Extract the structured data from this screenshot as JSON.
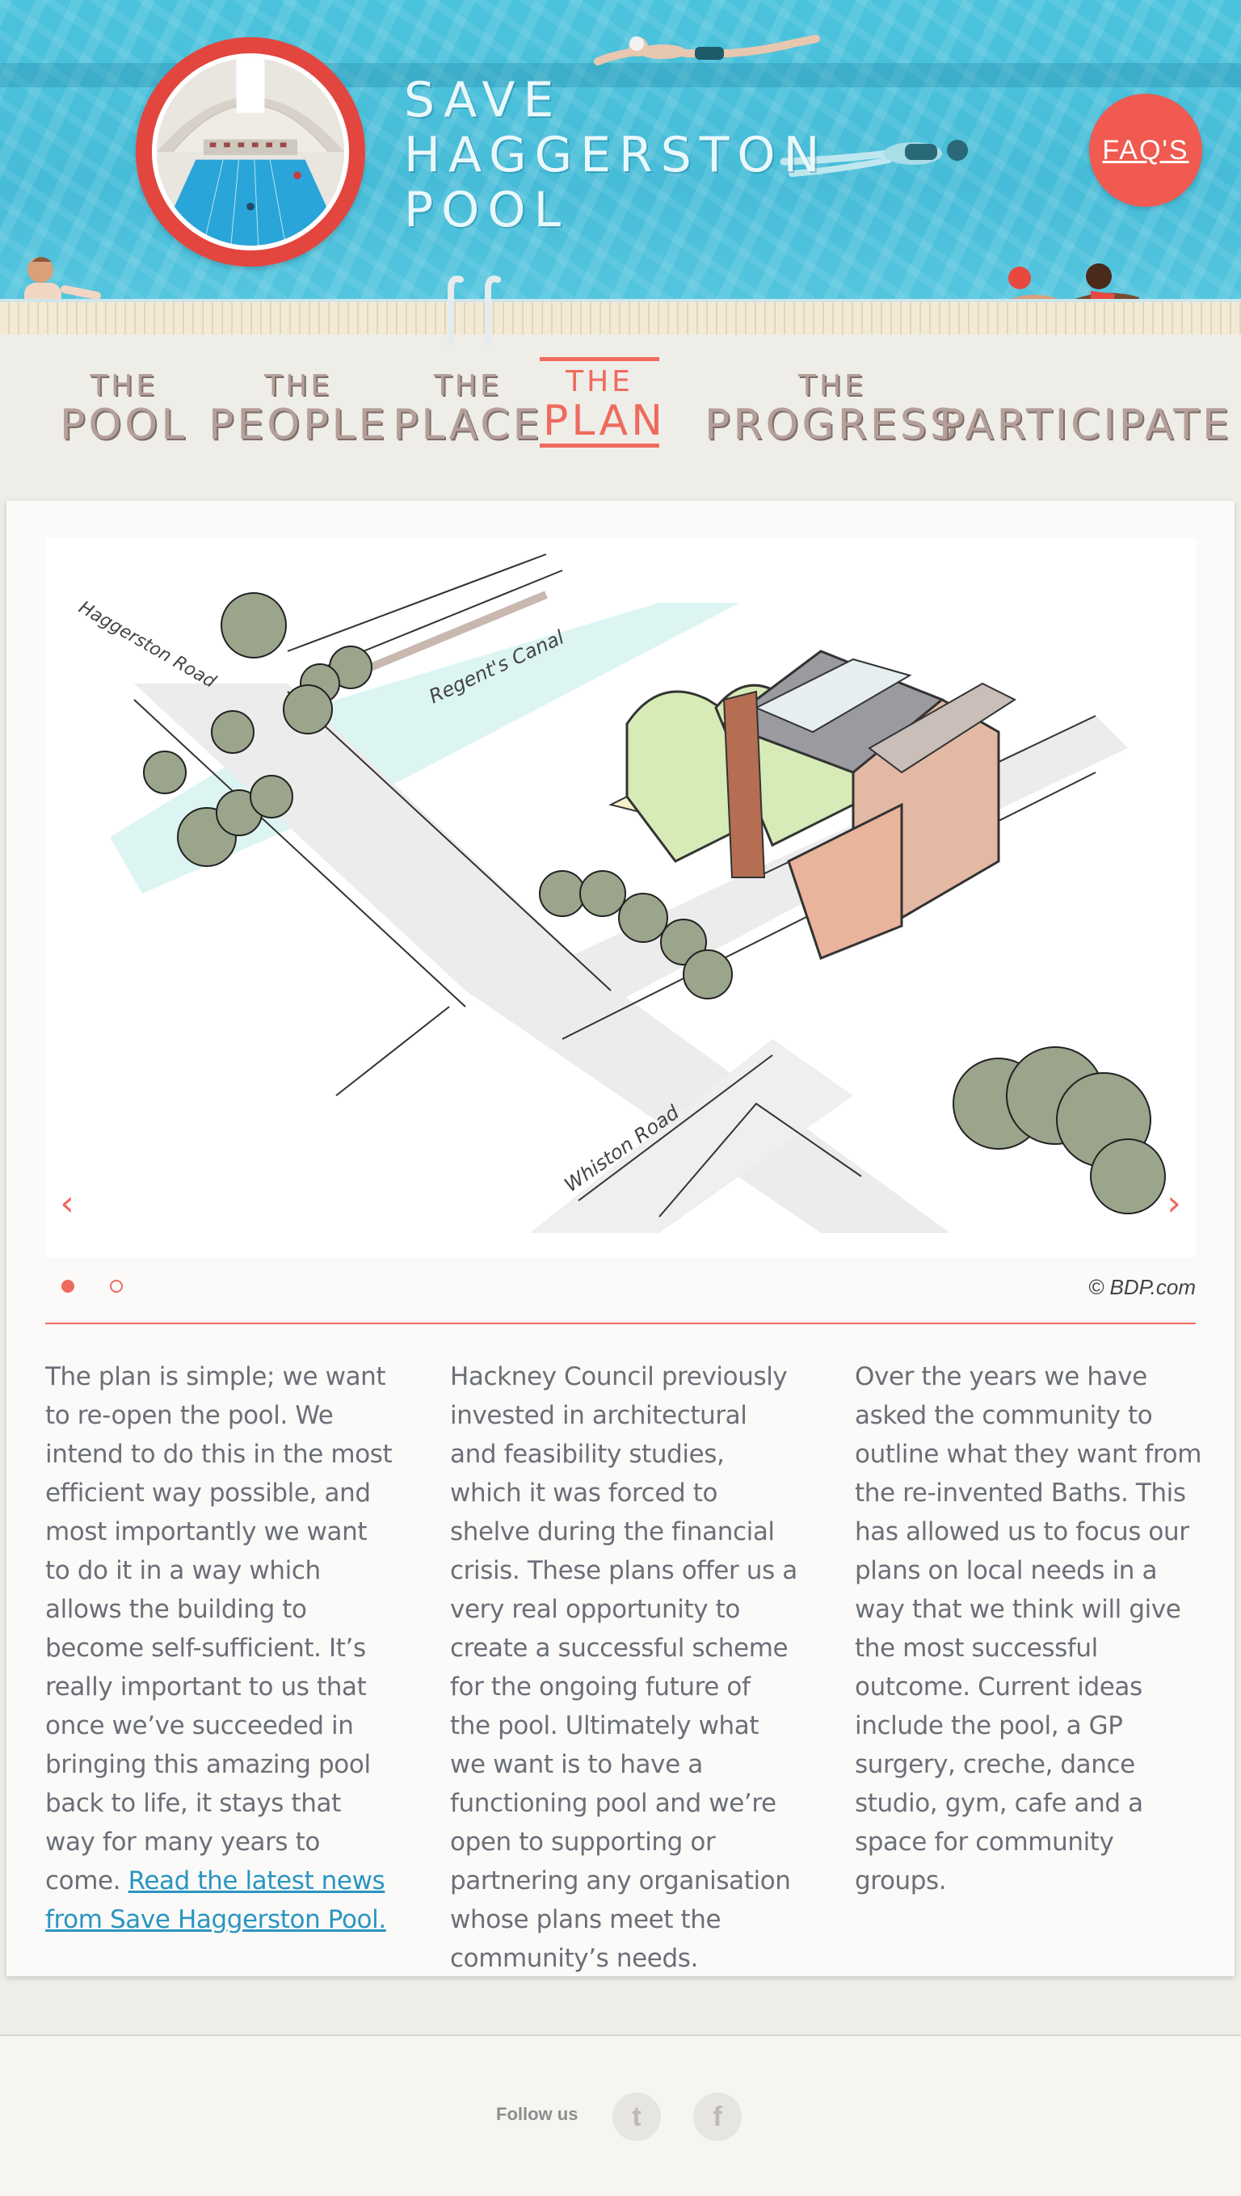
{
  "header": {
    "title_lines": [
      "SAVE",
      "HAGGERSTON",
      "POOL"
    ],
    "faq_label": "FAQ'S"
  },
  "nav": [
    {
      "small": "THE",
      "big": "POOL",
      "active": false
    },
    {
      "small": "THE",
      "big": "PEOPLE",
      "active": false
    },
    {
      "small": "THE",
      "big": "PLACE",
      "active": false
    },
    {
      "small": "THE",
      "big": "PLAN",
      "active": true
    },
    {
      "small": "THE",
      "big": "PROGRESS",
      "active": false
    },
    {
      "small": "",
      "big": "PARTICIPATE",
      "active": false
    }
  ],
  "slider": {
    "labels": {
      "road1": "Haggerston Road",
      "canal": "Regent's Canal",
      "road2": "Whiston Road"
    },
    "prev_icon": "chevron-left-icon",
    "next_icon": "chevron-right-icon",
    "credit": "© BDP.com",
    "slide_count": 2,
    "current_slide": 1
  },
  "columns": {
    "col1_text": "The plan is simple; we want to re-open the pool. We intend to do this in the most efficient way possible, and most importantly we want to do it in a way which allows the building to become self-sufficient. It’s really important to us that once we’ve succeeded in bringing this amazing pool back to life, it stays that way for many years to come. ",
    "col1_link": "Read the latest news from Save Haggerston Pool.",
    "col2_text": "Hackney Council previously invested in architectural and feasibility studies, which it was forced to shelve during the financial crisis. These plans offer us a very real opportunity to create a successful scheme for the ongoing future of the pool. Ultimately what we want is to have a functioning pool and we’re open to supporting or partnering any organisation whose plans meet the community’s needs.",
    "col3_text": "Over the years we have asked the community to outline what they want from the re-invented Baths. This has allowed us to focus our plans on local needs in a way that we think will give the most successful outcome. Current ideas include the pool, a GP surgery, creche, dance studio, gym, cafe and a space for community groups."
  },
  "footer": {
    "follow_label": "Follow us",
    "social": [
      {
        "name": "twitter-icon",
        "glyph": "t"
      },
      {
        "name": "facebook-icon",
        "glyph": "f"
      }
    ]
  },
  "colors": {
    "accent": "#ef6a5e",
    "pool": "#4cc3dc",
    "link": "#2a95c1",
    "body_text": "#6a6f78"
  }
}
